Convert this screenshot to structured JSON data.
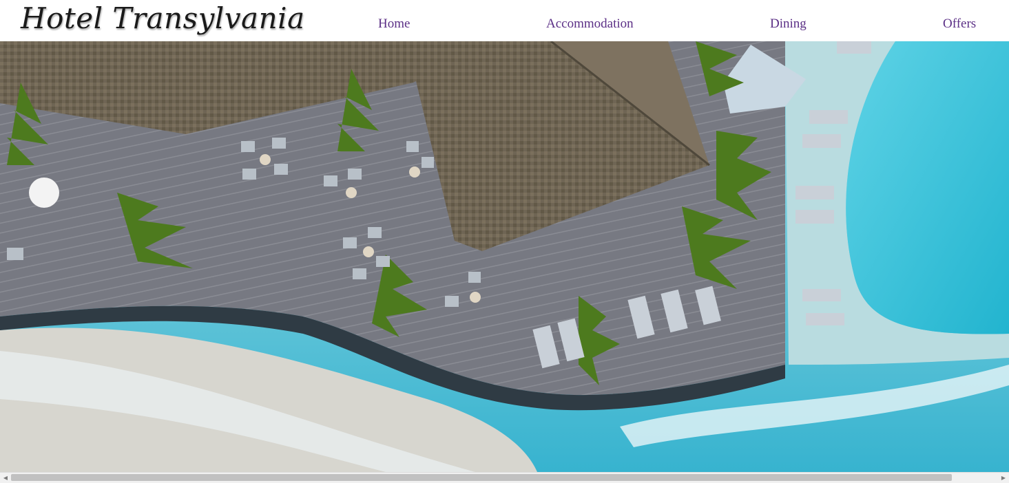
{
  "brand": {
    "name": "Hotel Transylvania"
  },
  "nav": {
    "items": [
      {
        "label": "Home"
      },
      {
        "label": "Accommodation"
      },
      {
        "label": "Dining"
      },
      {
        "label": "Offers"
      }
    ]
  },
  "hero": {
    "image_subject": "aerial view of resort restaurant deck, beach and pool"
  },
  "scrollbar": {
    "left_icon": "triangle-left-icon",
    "right_icon": "triangle-right-icon"
  },
  "colors": {
    "nav_link": "#5b2f86",
    "logo": "#1a1a1a",
    "pool": "#3ec6dc",
    "deck": "#7c7e86",
    "roof": "#6e6353"
  }
}
